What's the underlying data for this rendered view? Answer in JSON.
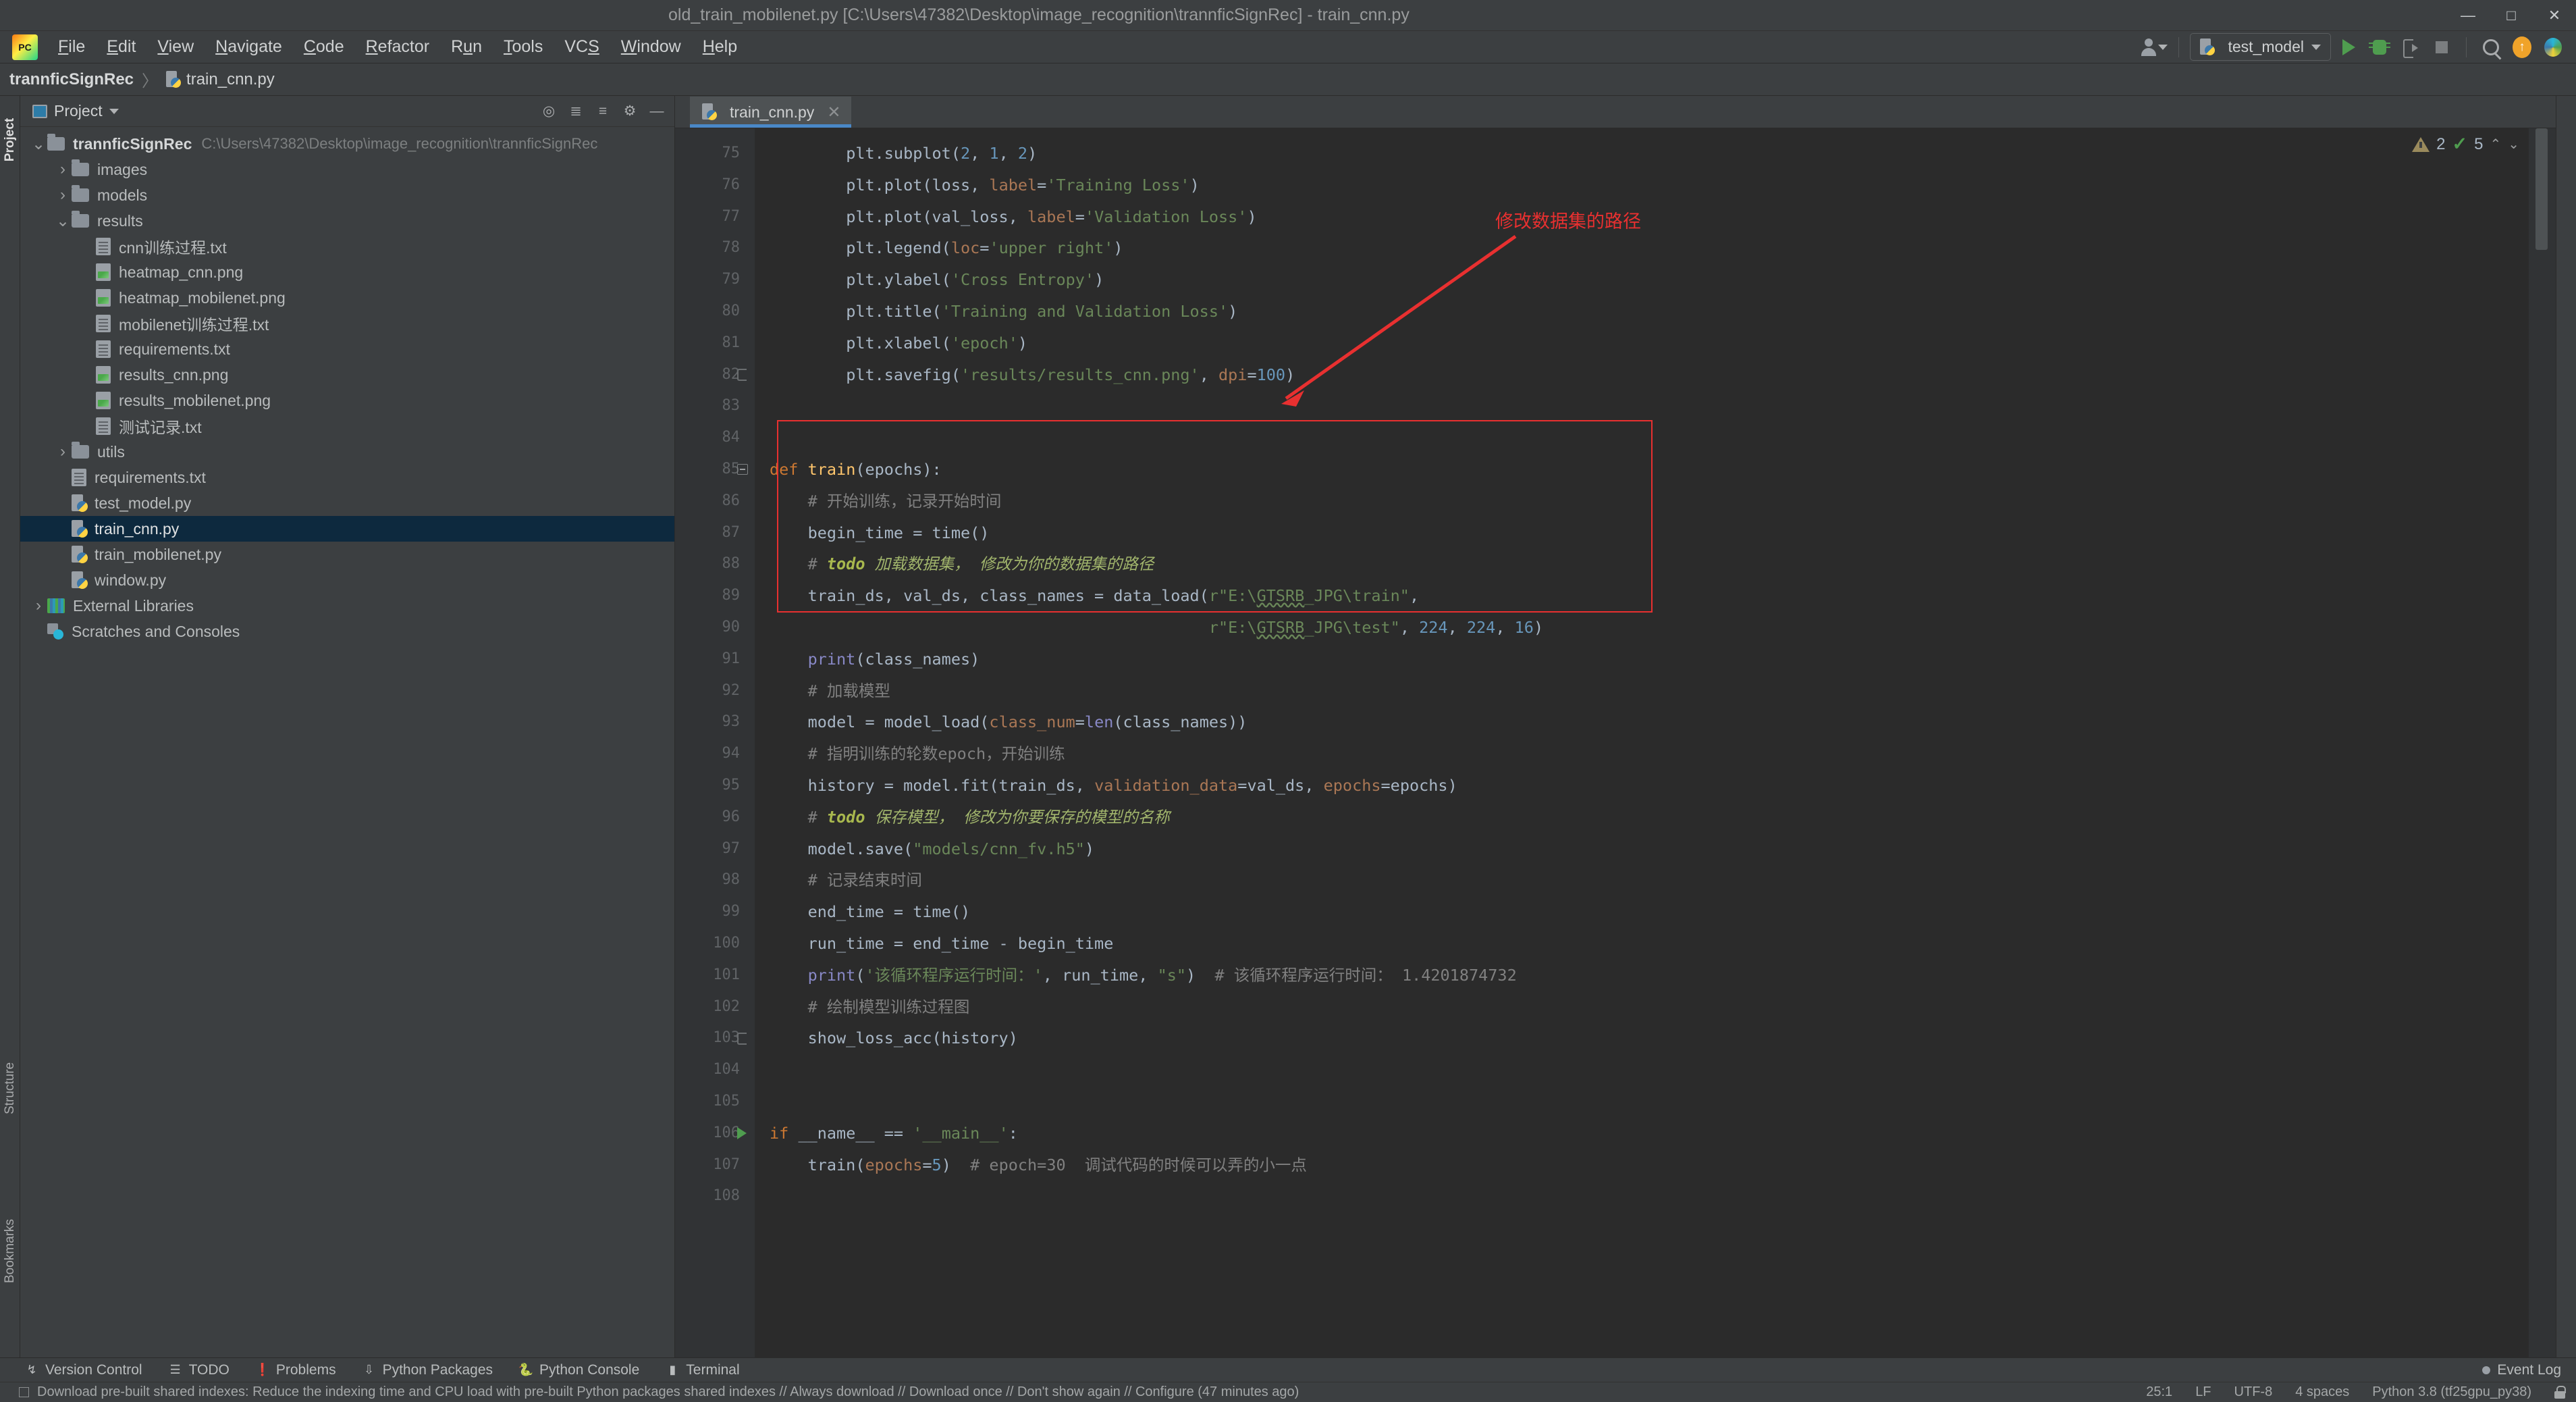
{
  "window": {
    "title": "old_train_mobilenet.py [C:\\Users\\47382\\Desktop\\image_recognition\\trannficSignRec] - train_cnn.py",
    "minimize": "—",
    "maximize": "□",
    "close": "✕"
  },
  "menu": {
    "items": [
      {
        "label": "File"
      },
      {
        "label": "Edit"
      },
      {
        "label": "View"
      },
      {
        "label": "Navigate"
      },
      {
        "label": "Code"
      },
      {
        "label": "Refactor"
      },
      {
        "label": "Run"
      },
      {
        "label": "Tools"
      },
      {
        "label": "VCS"
      },
      {
        "label": "Window"
      },
      {
        "label": "Help"
      }
    ]
  },
  "toolbar_right": {
    "run_config": "test_model",
    "icons": [
      "user-icon",
      "run-icon",
      "debug-icon",
      "coverage-icon",
      "stop-icon",
      "search-icon",
      "update-icon",
      "prism-icon"
    ]
  },
  "breadcrumb": {
    "root": "trannficSignRec",
    "separator": "〉",
    "file": "train_cnn.py"
  },
  "project_panel": {
    "title": "Project",
    "vertical_tabs": {
      "project": "Project",
      "structure": "Structure",
      "bookmarks": "Bookmarks"
    },
    "tree": [
      {
        "indent": 0,
        "arrow": "down",
        "icon": "folder",
        "name": "trannficSignRec",
        "bold": true,
        "path": "C:\\Users\\47382\\Desktop\\image_recognition\\trannficSignRec",
        "selected": false
      },
      {
        "indent": 1,
        "arrow": "right",
        "icon": "folder",
        "name": "images",
        "bold": false,
        "path": "",
        "selected": false
      },
      {
        "indent": 1,
        "arrow": "right",
        "icon": "folder",
        "name": "models",
        "bold": false,
        "path": "",
        "selected": false
      },
      {
        "indent": 1,
        "arrow": "down",
        "icon": "folder",
        "name": "results",
        "bold": false,
        "path": "",
        "selected": false
      },
      {
        "indent": 2,
        "arrow": "none",
        "icon": "txt",
        "name": "cnn训练过程.txt",
        "bold": false,
        "path": "",
        "selected": false
      },
      {
        "indent": 2,
        "arrow": "none",
        "icon": "png",
        "name": "heatmap_cnn.png",
        "bold": false,
        "path": "",
        "selected": false
      },
      {
        "indent": 2,
        "arrow": "none",
        "icon": "png",
        "name": "heatmap_mobilenet.png",
        "bold": false,
        "path": "",
        "selected": false
      },
      {
        "indent": 2,
        "arrow": "none",
        "icon": "txt",
        "name": "mobilenet训练过程.txt",
        "bold": false,
        "path": "",
        "selected": false
      },
      {
        "indent": 2,
        "arrow": "none",
        "icon": "txt",
        "name": "requirements.txt",
        "bold": false,
        "path": "",
        "selected": false
      },
      {
        "indent": 2,
        "arrow": "none",
        "icon": "png",
        "name": "results_cnn.png",
        "bold": false,
        "path": "",
        "selected": false
      },
      {
        "indent": 2,
        "arrow": "none",
        "icon": "png",
        "name": "results_mobilenet.png",
        "bold": false,
        "path": "",
        "selected": false
      },
      {
        "indent": 2,
        "arrow": "none",
        "icon": "txt",
        "name": "测试记录.txt",
        "bold": false,
        "path": "",
        "selected": false
      },
      {
        "indent": 1,
        "arrow": "right",
        "icon": "folder",
        "name": "utils",
        "bold": false,
        "path": "",
        "selected": false
      },
      {
        "indent": 1,
        "arrow": "none",
        "icon": "txt",
        "name": "requirements.txt",
        "bold": false,
        "path": "",
        "selected": false
      },
      {
        "indent": 1,
        "arrow": "none",
        "icon": "py",
        "name": "test_model.py",
        "bold": false,
        "path": "",
        "selected": false
      },
      {
        "indent": 1,
        "arrow": "none",
        "icon": "py",
        "name": "train_cnn.py",
        "bold": false,
        "path": "",
        "selected": true
      },
      {
        "indent": 1,
        "arrow": "none",
        "icon": "py",
        "name": "train_mobilenet.py",
        "bold": false,
        "path": "",
        "selected": false
      },
      {
        "indent": 1,
        "arrow": "none",
        "icon": "py",
        "name": "window.py",
        "bold": false,
        "path": "",
        "selected": false
      },
      {
        "indent": 0,
        "arrow": "right",
        "icon": "lib",
        "name": "External Libraries",
        "bold": false,
        "path": "",
        "selected": false
      },
      {
        "indent": 0,
        "arrow": "none",
        "icon": "scratch",
        "name": "Scratches and Consoles",
        "bold": false,
        "path": "",
        "selected": false
      }
    ]
  },
  "editor": {
    "tab": {
      "label": "train_cnn.py",
      "close": "✕"
    },
    "inspection": {
      "warning_count": "2",
      "ok_count": "5",
      "up": "⌃",
      "down": "⌄"
    },
    "first_line_number": 75,
    "lines": [
      {
        "n": 75,
        "marker": "",
        "html": "        <span class='txt'>plt.subplot(</span><span class='num'>2</span><span class='txt'>,</span> <span class='num'>1</span><span class='txt'>,</span> <span class='num'>2</span><span class='txt'>)</span>"
      },
      {
        "n": 76,
        "marker": "",
        "html": "        <span class='txt'>plt.plot(loss,</span> <span class='prm'>label</span><span class='txt'>=</span><span class='str'>'Training Loss'</span><span class='txt'>)</span>"
      },
      {
        "n": 77,
        "marker": "",
        "html": "        <span class='txt'>plt.plot(val_loss,</span> <span class='prm'>label</span><span class='txt'>=</span><span class='str'>'Validation Loss'</span><span class='txt'>)</span>"
      },
      {
        "n": 78,
        "marker": "",
        "html": "        <span class='txt'>plt.legend(</span><span class='prm'>loc</span><span class='txt'>=</span><span class='str'>'upper right'</span><span class='txt'>)</span>"
      },
      {
        "n": 79,
        "marker": "",
        "html": "        <span class='txt'>plt.ylabel(</span><span class='str'>'Cross Entropy'</span><span class='txt'>)</span>"
      },
      {
        "n": 80,
        "marker": "",
        "html": "        <span class='txt'>plt.title(</span><span class='str'>'Training and Validation Loss'</span><span class='txt'>)</span>"
      },
      {
        "n": 81,
        "marker": "",
        "html": "        <span class='txt'>plt.xlabel(</span><span class='str'>'epoch'</span><span class='txt'>)</span>"
      },
      {
        "n": 82,
        "marker": "foldend",
        "html": "        <span class='txt'>plt.savefig(</span><span class='str'>'results/results_cnn.png'</span><span class='txt'>,</span> <span class='prm'>dpi</span><span class='txt'>=</span><span class='num'>100</span><span class='txt'>)</span>"
      },
      {
        "n": 83,
        "marker": "",
        "html": ""
      },
      {
        "n": 84,
        "marker": "",
        "html": ""
      },
      {
        "n": 85,
        "marker": "fold",
        "html": "<span class='kw'>def</span> <span class='fn'>train</span><span class='txt'>(epochs):</span>"
      },
      {
        "n": 86,
        "marker": "",
        "html": "    <span class='cmt'># 开始训练，记录开始时间</span>"
      },
      {
        "n": 87,
        "marker": "",
        "html": "    <span class='txt'>begin_time = time()</span>"
      },
      {
        "n": 88,
        "marker": "",
        "html": "    <span class='cmt'># </span><span class='todow'>todo</span> <span class='todo'>加载数据集， 修改为你的数据集的路径</span>"
      },
      {
        "n": 89,
        "marker": "",
        "html": "    <span class='txt'>train_ds, val_ds, class_names = data_load(</span><span class='str'>r\"E:\\</span><span class='str sq'>GTSRB</span><span class='str'>_JPG\\train\"</span><span class='txt'>,</span>"
      },
      {
        "n": 90,
        "marker": "",
        "html": "                                              <span class='str'>r\"E:\\</span><span class='str sq'>GTSRB</span><span class='str'>_JPG\\test\"</span><span class='txt'>,</span> <span class='num'>224</span><span class='txt'>,</span> <span class='num'>224</span><span class='txt'>,</span> <span class='num'>16</span><span class='txt'>)</span>"
      },
      {
        "n": 91,
        "marker": "",
        "html": "    <span class='bfn'>print</span><span class='txt'>(class_names)</span>"
      },
      {
        "n": 92,
        "marker": "",
        "html": "    <span class='cmt'># 加载模型</span>"
      },
      {
        "n": 93,
        "marker": "",
        "html": "    <span class='txt'>model = model_load(</span><span class='prm'>class_num</span><span class='txt'>=</span><span class='bfn'>len</span><span class='txt'>(class_names))</span>"
      },
      {
        "n": 94,
        "marker": "",
        "html": "    <span class='cmt'># 指明训练的轮数epoch，开始训练</span>"
      },
      {
        "n": 95,
        "marker": "",
        "html": "    <span class='txt'>history = model.fit(train_ds,</span> <span class='prm'>validation_data</span><span class='txt'>=val_ds,</span> <span class='prm'>epochs</span><span class='txt'>=epochs)</span>"
      },
      {
        "n": 96,
        "marker": "",
        "html": "    <span class='cmt'># </span><span class='todow'>todo</span> <span class='todo'>保存模型， 修改为你要保存的模型的名称</span>"
      },
      {
        "n": 97,
        "marker": "",
        "html": "    <span class='txt'>model.save(</span><span class='str'>\"models/cnn_fv.h5\"</span><span class='txt'>)</span>"
      },
      {
        "n": 98,
        "marker": "",
        "html": "    <span class='cmt'># 记录结束时间</span>"
      },
      {
        "n": 99,
        "marker": "",
        "html": "    <span class='txt'>end_time = time()</span>"
      },
      {
        "n": 100,
        "marker": "",
        "html": "    <span class='txt'>run_time = end_time - begin_time</span>"
      },
      {
        "n": 101,
        "marker": "",
        "html": "    <span class='bfn'>print</span><span class='txt'>(</span><span class='str'>'该循环程序运行时间：'</span><span class='txt'>, run_time,</span> <span class='str'>\"s\"</span><span class='txt'>)</span>  <span class='cmt'># 该循环程序运行时间： 1.4201874732</span>"
      },
      {
        "n": 102,
        "marker": "",
        "html": "    <span class='cmt'># 绘制模型训练过程图</span>"
      },
      {
        "n": 103,
        "marker": "foldend",
        "html": "    <span class='txt'>show_loss_acc(history)</span>"
      },
      {
        "n": 104,
        "marker": "",
        "html": ""
      },
      {
        "n": 105,
        "marker": "",
        "html": ""
      },
      {
        "n": 106,
        "marker": "run",
        "html": "<span class='kw'>if</span> <span class='txt'>__name__ ==</span> <span class='str'>'__main__'</span><span class='txt'>:</span>"
      },
      {
        "n": 107,
        "marker": "",
        "html": "    <span class='txt'>train(</span><span class='prm'>epochs</span><span class='txt'>=</span><span class='num'>5</span><span class='txt'>)</span>  <span class='cmt'># epoch=30  调试代码的时候可以弄的小一点</span>"
      },
      {
        "n": 108,
        "marker": "",
        "html": ""
      }
    ]
  },
  "annotation": {
    "text": "修改数据集的路径",
    "color": "#e83030"
  },
  "bottom_tools": {
    "items": [
      {
        "label": "Version Control",
        "icon": "branch-icon"
      },
      {
        "label": "TODO",
        "icon": "list-icon"
      },
      {
        "label": "Problems",
        "icon": "exclamation-icon"
      },
      {
        "label": "Python Packages",
        "icon": "packages-icon"
      },
      {
        "label": "Python Console",
        "icon": "python-icon"
      },
      {
        "label": "Terminal",
        "icon": "terminal-icon"
      }
    ],
    "event_log": "Event Log"
  },
  "statusbar": {
    "message": "Download pre-built shared indexes: Reduce the indexing time and CPU load with pre-built Python packages shared indexes // Always download // Download once // Don't show again // Configure   (47 minutes ago)",
    "caret": "25:1",
    "line_sep": "LF",
    "encoding": "UTF-8",
    "indent": "4 spaces",
    "interpreter": "Python 3.8 (tf25gpu_py38)",
    "lock": "lock-icon"
  }
}
